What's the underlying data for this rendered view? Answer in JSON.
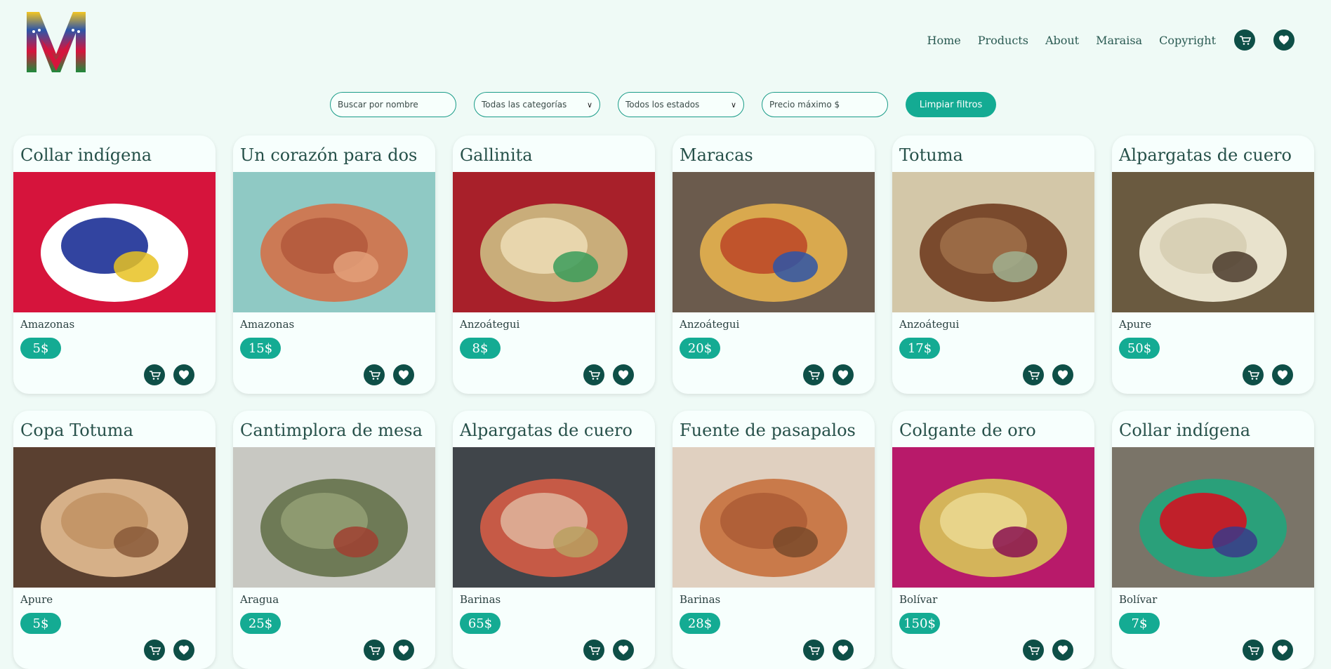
{
  "brand": {
    "logo_letter": "M"
  },
  "nav": {
    "links": [
      "Home",
      "Products",
      "About",
      "Maraisa",
      "Copyright"
    ],
    "cart_icon": "cart-icon",
    "favorites_icon": "heart-icon"
  },
  "filters": {
    "search_placeholder": "Buscar por nombre",
    "category_selected": "Todas las categorías",
    "state_selected": "Todos los estados",
    "max_price_placeholder": "Precio máximo $",
    "clear_label": "Limpiar filtros"
  },
  "colors": {
    "background": "#effaf6",
    "accent": "#14ab93",
    "dark": "#0e4f47"
  },
  "products": [
    {
      "title": "Collar indígena",
      "state": "Amazonas",
      "price": "5$",
      "photo": "bead-necklace",
      "colors": [
        "#d6143c",
        "#ffffff",
        "#3244a0",
        "#e8c222"
      ]
    },
    {
      "title": "Un corazón para dos",
      "state": "Amazonas",
      "price": "15$",
      "photo": "clay-cups",
      "colors": [
        "#8fc9c4",
        "#cc7a55",
        "#b65d3f",
        "#e3a07a"
      ]
    },
    {
      "title": "Gallinita",
      "state": "Anzoátegui",
      "price": "8$",
      "photo": "woven-hen",
      "colors": [
        "#a8202a",
        "#c9ad7a",
        "#e8d6ad",
        "#3a9c5a"
      ]
    },
    {
      "title": "Maracas",
      "state": "Anzoátegui",
      "price": "20$",
      "photo": "maracas",
      "colors": [
        "#6b5b4d",
        "#d9a94e",
        "#c0542c",
        "#2d55a8"
      ]
    },
    {
      "title": "Totuma",
      "state": "Anzoátegui",
      "price": "17$",
      "photo": "gourd-bag",
      "colors": [
        "#d3c7a8",
        "#7a4a2d",
        "#9a6a45",
        "#a0b090"
      ]
    },
    {
      "title": "Alpargatas de cuero",
      "state": "Apure",
      "price": "50$",
      "photo": "leather-sandals",
      "colors": [
        "#6a5a40",
        "#e8e2cc",
        "#d8d0b5",
        "#4a3a2a"
      ]
    },
    {
      "title": "Copa Totuma",
      "state": "Apure",
      "price": "5$",
      "photo": "gourd-cup",
      "colors": [
        "#5a4030",
        "#d6b088",
        "#c49668",
        "#8a5a3a"
      ]
    },
    {
      "title": "Cantimplora de mesa",
      "state": "Aragua",
      "price": "25$",
      "photo": "ceramic-flask",
      "colors": [
        "#c8c8c2",
        "#6e7a56",
        "#8e9a70",
        "#a04030"
      ]
    },
    {
      "title": "Alpargatas de cuero",
      "state": "Barinas",
      "price": "65$",
      "photo": "red-sandals",
      "colors": [
        "#40454a",
        "#c65a46",
        "#dca890",
        "#b8a060"
      ]
    },
    {
      "title": "Fuente de pasapalos",
      "state": "Barinas",
      "price": "28$",
      "photo": "carved-bowl",
      "colors": [
        "#e0d0c0",
        "#c97a4a",
        "#b06038",
        "#7a4a2a"
      ]
    },
    {
      "title": "Colgante de oro",
      "state": "Bolívar",
      "price": "150$",
      "photo": "gold-pendant",
      "colors": [
        "#b81a6a",
        "#d4b45a",
        "#e8d48a",
        "#8a1050"
      ]
    },
    {
      "title": "Collar indígena",
      "state": "Bolívar",
      "price": "7$",
      "photo": "beaded-collar",
      "colors": [
        "#7a7468",
        "#2aa07a",
        "#c0202a",
        "#3a3a8a"
      ]
    }
  ]
}
